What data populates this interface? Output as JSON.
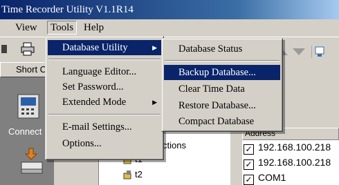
{
  "window": {
    "title": "Time Recorder Utility V1.1R14"
  },
  "menubar": {
    "view": "View",
    "tools": "Tools",
    "help": "Help"
  },
  "left_panel": {
    "shortcut_label": "Short Cut",
    "connect_label": "Connect"
  },
  "tools_menu": {
    "database_utility": "Database Utility",
    "language_editor": "Language Editor...",
    "set_password": "Set Password...",
    "extended_mode": "Extended Mode",
    "email_settings": "E-mail Settings...",
    "options": "Options..."
  },
  "database_submenu": {
    "status": "Database Status",
    "backup": "Backup Database...",
    "clear_time": "Clear Time Data",
    "restore": "Restore Database...",
    "compact": "Compact Database"
  },
  "tree": {
    "partial_label": "ctions",
    "t1": "t1",
    "t2": "t2"
  },
  "list": {
    "header": "Address",
    "rows": [
      "192.168.100.218",
      "192.168.100.218",
      "COM1"
    ]
  },
  "colors": {
    "highlight": "#0a246a",
    "titlebar": "#0a246a",
    "face": "#d4d0c8"
  }
}
